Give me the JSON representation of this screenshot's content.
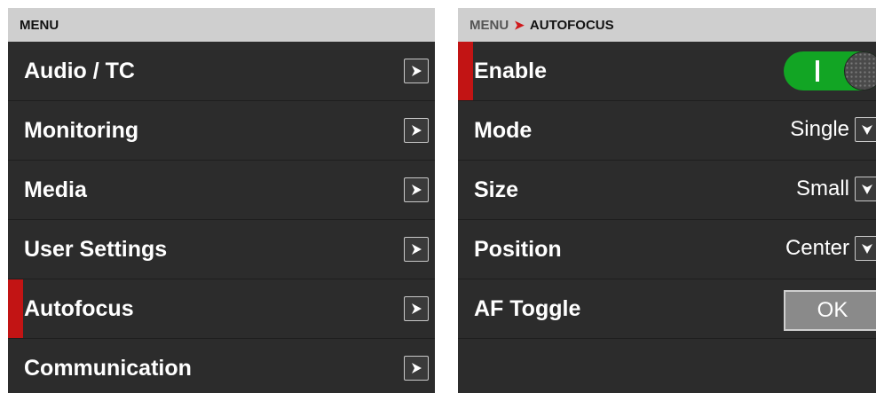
{
  "left_panel": {
    "header": "MENU",
    "items": [
      {
        "label": "Audio / TC"
      },
      {
        "label": "Monitoring"
      },
      {
        "label": "Media"
      },
      {
        "label": "User Settings"
      },
      {
        "label": "Autofocus",
        "selected": true
      },
      {
        "label": "Communication"
      }
    ],
    "item_icon": "chevron-right-icon"
  },
  "right_panel": {
    "breadcrumb": {
      "root": "MENU",
      "separator": "➤",
      "current": "AUTOFOCUS"
    },
    "rows": {
      "enable": {
        "label": "Enable",
        "state": "on"
      },
      "mode": {
        "label": "Mode",
        "value": "Single"
      },
      "size": {
        "label": "Size",
        "value": "Small"
      },
      "position": {
        "label": "Position",
        "value": "Center"
      },
      "af_toggle": {
        "label": "AF Toggle",
        "button": "OK"
      }
    }
  },
  "colors": {
    "panel_bg": "#2c2c2c",
    "header_bg": "#cfcfcf",
    "selection_accent": "#c21414",
    "toggle_on": "#12a524",
    "breadcrumb_arrow": "#d0191c"
  }
}
